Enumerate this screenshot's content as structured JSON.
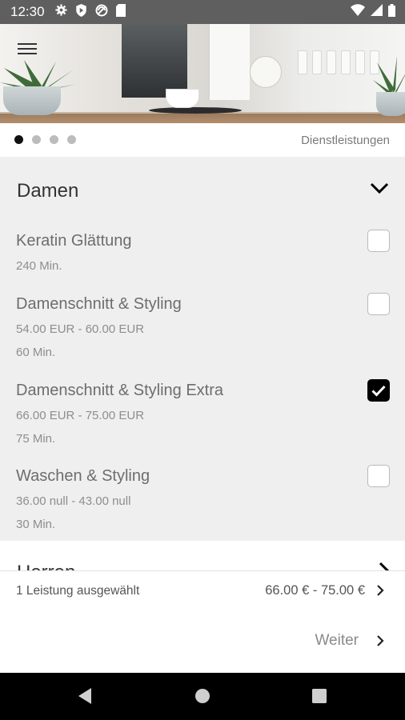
{
  "status_bar": {
    "time": "12:30",
    "icons": [
      "settings-icon",
      "play-protect-icon",
      "vpn-icon",
      "sim-card-icon",
      "wifi-icon",
      "signal-icon",
      "battery-icon"
    ]
  },
  "hero": {
    "menu_icon": "hamburger-menu-icon",
    "carousel": {
      "pages": 4,
      "active_index": 0
    }
  },
  "subheader": {
    "label": "Dienstleistungen"
  },
  "category": {
    "title": "Damen",
    "expanded": true,
    "services": [
      {
        "name": "Keratin Glättung",
        "duration": "240 Min.",
        "checked": false
      },
      {
        "name": "Damenschnitt & Styling",
        "price": "54.00 EUR - 60.00 EUR",
        "duration": "60 Min.",
        "checked": false
      },
      {
        "name": "Damenschnitt & Styling Extra",
        "price": "66.00 EUR - 75.00 EUR",
        "duration": "75 Min.",
        "checked": true
      },
      {
        "name": "Waschen & Styling",
        "price": "36.00 null - 43.00 null",
        "duration": "30 Min.",
        "checked": false
      }
    ]
  },
  "next_category": {
    "title": "Herren"
  },
  "summary": {
    "selected_text": "1 Leistung ausgewählt",
    "price_range": "66.00 € - 75.00 €"
  },
  "next_button": {
    "label": "Weiter"
  },
  "nav_bar": {
    "buttons": [
      "back-icon",
      "home-icon",
      "recents-icon"
    ]
  },
  "colors": {
    "accent": "#000000",
    "section_bg": "#efefef",
    "text_muted": "#6d6d6d"
  }
}
